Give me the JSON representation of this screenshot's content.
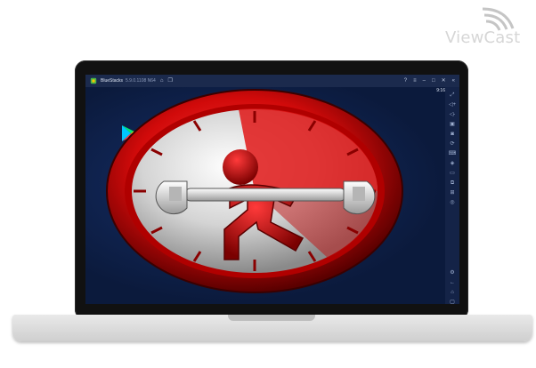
{
  "watermark": {
    "text": "ViewCast"
  },
  "emulator": {
    "app_name": "BlueStacks",
    "version_text": "5.9.0.1108 N64",
    "clock": "9:16",
    "titlebar_icons": [
      "home-icon",
      "layers-icon"
    ],
    "window_controls": [
      "help-icon",
      "menu-icon",
      "minimize-icon",
      "maximize-icon",
      "close-icon",
      "collapse-icon"
    ],
    "sidebar_icons": [
      "fullscreen-icon",
      "volume-up-icon",
      "volume-down-icon",
      "screen-record-icon",
      "screenshot-icon",
      "rotate-icon",
      "keyboard-icon",
      "gamepad-icon",
      "folder-icon",
      "multi-instance-icon",
      "macro-icon",
      "eco-mode-icon",
      "settings-icon",
      "back-icon",
      "home-nav-icon",
      "recents-icon"
    ]
  },
  "desktop": {
    "apps": [
      {
        "label": "Play Store",
        "icon": "play-store-icon"
      }
    ]
  },
  "app_graphic": {
    "description_icon": "speed-repair-icon",
    "colors": {
      "ring": "#d10a0a",
      "figure": "#c00000",
      "dial": "#e6e6e6",
      "wrench": "#d8d8d8"
    }
  }
}
